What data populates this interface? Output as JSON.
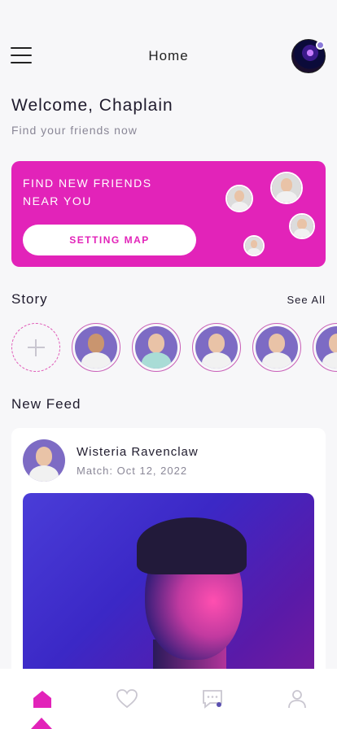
{
  "header": {
    "title": "Home",
    "menu_icon": "hamburger-menu-icon",
    "avatar_status_color": "#8a7ad9"
  },
  "welcome": {
    "title": "Welcome, Chaplain",
    "subtitle": "Find your friends now"
  },
  "banner": {
    "line1": "FIND NEW FRIENDS",
    "line2": "NEAR YOU",
    "button_label": "SETTING MAP",
    "color": "#e223b9"
  },
  "story": {
    "title": "Story",
    "see_all": "See All",
    "add_icon": "plus-icon"
  },
  "feed": {
    "title": "New Feed",
    "post": {
      "name": "Wisteria Ravenclaw",
      "date": "Match: Oct 12, 2022"
    }
  },
  "bottom_nav": {
    "items": [
      {
        "icon": "home-icon",
        "active": true
      },
      {
        "icon": "heart-icon",
        "active": false
      },
      {
        "icon": "chat-icon",
        "active": false
      },
      {
        "icon": "profile-icon",
        "active": false
      }
    ],
    "accent": "#e223b9"
  }
}
